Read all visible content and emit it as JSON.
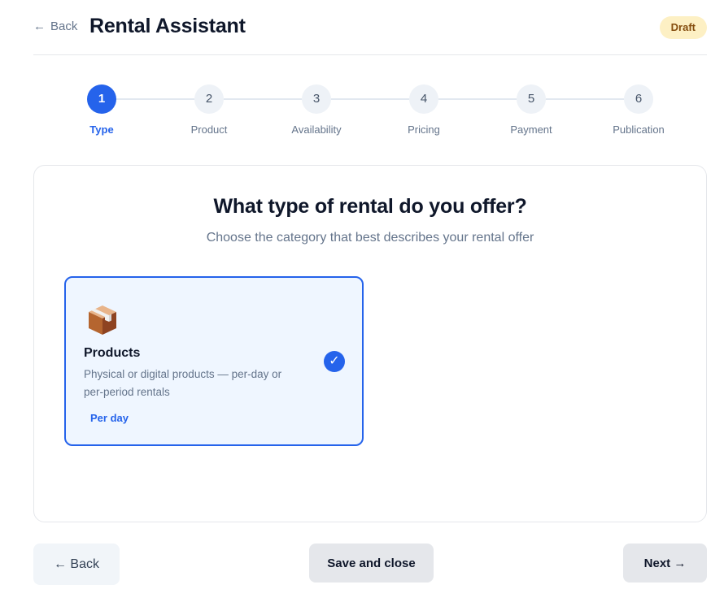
{
  "header": {
    "back_arrow": "←",
    "back_label": "Back",
    "title": "Rental Assistant",
    "status_badge": "Draft"
  },
  "steps": [
    {
      "number": "1",
      "label": "Type",
      "active": true
    },
    {
      "number": "2",
      "label": "Product",
      "active": false
    },
    {
      "number": "3",
      "label": "Availability",
      "active": false
    },
    {
      "number": "4",
      "label": "Pricing",
      "active": false
    },
    {
      "number": "5",
      "label": "Payment",
      "active": false
    },
    {
      "number": "6",
      "label": "Publication",
      "active": false
    }
  ],
  "main": {
    "question": "What type of rental do you offer?",
    "subtitle": "Choose the category that best describes your rental offer",
    "options": [
      {
        "icon": "package-box-icon",
        "title": "Products",
        "description": "Physical or digital products — per-day or per-period rentals",
        "tag": "Per day",
        "selected": true,
        "check_glyph": "✓"
      }
    ]
  },
  "footer": {
    "back_label": "← Back",
    "save_label": "Save and close",
    "next_label": "Next →"
  },
  "colors": {
    "accent": "#2563eb",
    "badge_bg": "#fdf0c4",
    "badge_text": "#854d0e",
    "selected_bg": "#eff6ff"
  }
}
